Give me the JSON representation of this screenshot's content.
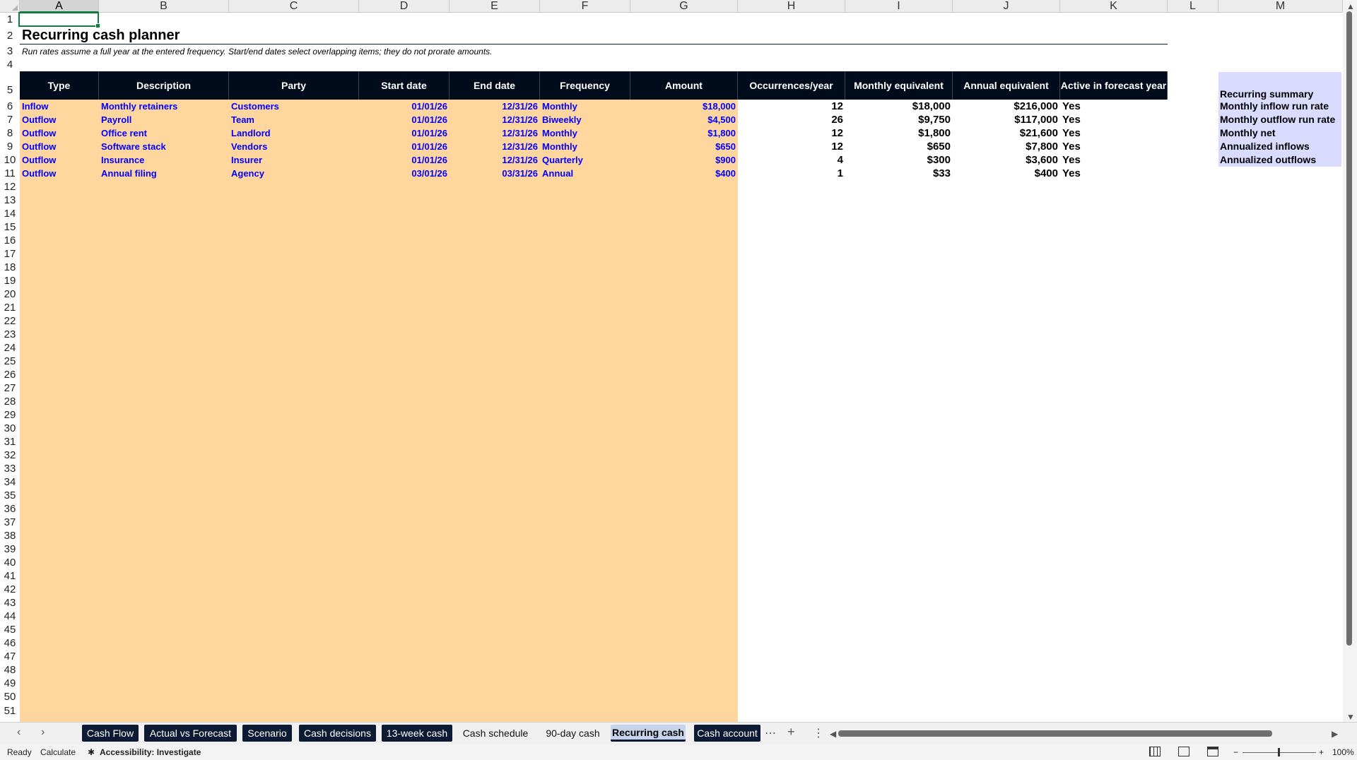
{
  "columns": [
    "A",
    "B",
    "C",
    "D",
    "E",
    "F",
    "G",
    "H",
    "I",
    "J",
    "K",
    "L",
    "M"
  ],
  "selected_column": "A",
  "rows": [
    "1",
    "2",
    "3",
    "4",
    "5",
    "6",
    "7",
    "8",
    "9",
    "10",
    "11",
    "12",
    "13",
    "14",
    "15",
    "16",
    "17",
    "18",
    "19",
    "20",
    "21",
    "22",
    "23",
    "24",
    "25",
    "26",
    "27",
    "28",
    "29",
    "30",
    "31",
    "32",
    "33",
    "34",
    "35",
    "36",
    "37",
    "38",
    "39",
    "40",
    "41",
    "42",
    "43",
    "44",
    "45",
    "46",
    "47",
    "48",
    "49",
    "50",
    "51"
  ],
  "sheet": {
    "title": "Recurring cash planner",
    "note": "Run rates assume a full year at the entered frequency. Start/end dates select overlapping items; they do not prorate amounts.",
    "headers": [
      "Type",
      "Description",
      "Party",
      "Start date",
      "End date",
      "Frequency",
      "Amount",
      "Occurrences/year",
      "Monthly equivalent",
      "Annual equivalent",
      "Active in forecast year"
    ],
    "items": [
      {
        "type": "Inflow",
        "description": "Monthly retainers",
        "party": "Customers",
        "start": "01/01/26",
        "end": "12/31/26",
        "frequency": "Monthly",
        "amount": "$18,000",
        "occ": "12",
        "monthly": "$18,000",
        "annual": "$216,000",
        "active": "Yes"
      },
      {
        "type": "Outflow",
        "description": "Payroll",
        "party": "Team",
        "start": "01/01/26",
        "end": "12/31/26",
        "frequency": "Biweekly",
        "amount": "$4,500",
        "occ": "26",
        "monthly": "$9,750",
        "annual": "$117,000",
        "active": "Yes"
      },
      {
        "type": "Outflow",
        "description": "Office rent",
        "party": "Landlord",
        "start": "01/01/26",
        "end": "12/31/26",
        "frequency": "Monthly",
        "amount": "$1,800",
        "occ": "12",
        "monthly": "$1,800",
        "annual": "$21,600",
        "active": "Yes"
      },
      {
        "type": "Outflow",
        "description": "Software stack",
        "party": "Vendors",
        "start": "01/01/26",
        "end": "12/31/26",
        "frequency": "Monthly",
        "amount": "$650",
        "occ": "12",
        "monthly": "$650",
        "annual": "$7,800",
        "active": "Yes"
      },
      {
        "type": "Outflow",
        "description": "Insurance",
        "party": "Insurer",
        "start": "01/01/26",
        "end": "12/31/26",
        "frequency": "Quarterly",
        "amount": "$900",
        "occ": "4",
        "monthly": "$300",
        "annual": "$3,600",
        "active": "Yes"
      },
      {
        "type": "Outflow",
        "description": "Annual filing",
        "party": "Agency",
        "start": "03/01/26",
        "end": "03/31/26",
        "frequency": "Annual",
        "amount": "$400",
        "occ": "1",
        "monthly": "$33",
        "annual": "$400",
        "active": "Yes"
      }
    ],
    "summary": {
      "title": "Recurring summary",
      "labels": [
        "Monthly inflow run rate",
        "Monthly outflow run rate",
        "Monthly net",
        "Annualized inflows",
        "Annualized outflows"
      ]
    }
  },
  "tabs": [
    {
      "label": "Cash Flow",
      "style": "dark"
    },
    {
      "label": "Actual vs Forecast",
      "style": "dark"
    },
    {
      "label": "Scenario",
      "style": "dark"
    },
    {
      "label": "Cash decisions",
      "style": "dark"
    },
    {
      "label": "13-week cash",
      "style": "dark"
    },
    {
      "label": "Cash schedule",
      "style": "plain"
    },
    {
      "label": "90-day cash",
      "style": "plain"
    },
    {
      "label": "Recurring cash",
      "style": "active"
    },
    {
      "label": "Cash account",
      "style": "dark"
    }
  ],
  "status": {
    "ready": "Ready",
    "calculate": "Calculate",
    "accessibility": "Accessibility: Investigate",
    "zoom": "100%"
  },
  "icons": {
    "prev": "‹",
    "next": "›",
    "more": "⋯",
    "add": "+",
    "options": "⋮",
    "accessibility": "✱",
    "minus": "−",
    "plus": "+"
  }
}
